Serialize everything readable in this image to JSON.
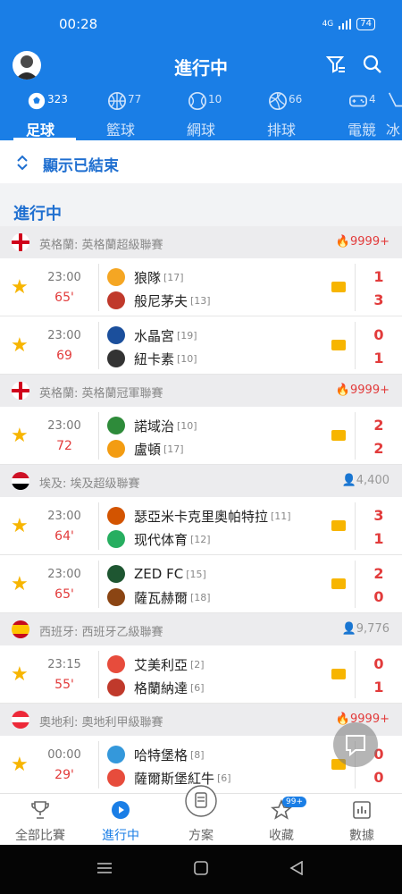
{
  "status": {
    "time": "00:28",
    "battery": "74",
    "network": "4G"
  },
  "header": {
    "title": "進行中"
  },
  "tabs": [
    {
      "label": "足球",
      "count": "323"
    },
    {
      "label": "籃球",
      "count": "77"
    },
    {
      "label": "網球",
      "count": "10"
    },
    {
      "label": "排球",
      "count": "66"
    },
    {
      "label": "電競",
      "count": "4"
    },
    {
      "label": "冰",
      "count": ""
    }
  ],
  "show_ended": "顯示已結束",
  "section_title": "進行中",
  "leagues": [
    {
      "name": "英格蘭: 英格蘭超級聯賽",
      "count": "9999+",
      "hot": true
    },
    {
      "name": "英格蘭: 英格蘭冠軍聯賽",
      "count": "9999+",
      "hot": true
    },
    {
      "name": "埃及: 埃及超级聯賽",
      "count": "4,400",
      "hot": false
    },
    {
      "name": "西班牙: 西班牙乙級聯賽",
      "count": "9,776",
      "hot": false
    },
    {
      "name": "奧地利: 奧地利甲級聯賽",
      "count": "9999+",
      "hot": true
    }
  ],
  "matches": [
    {
      "time": "23:00",
      "minute": "65'",
      "home": {
        "name": "狼隊",
        "rank": "[17]",
        "score": "1"
      },
      "away": {
        "name": "般尼茅夫",
        "rank": "[13]",
        "score": "3"
      }
    },
    {
      "time": "23:00",
      "minute": "69",
      "home": {
        "name": "水晶宮",
        "rank": "[19]",
        "score": "0"
      },
      "away": {
        "name": "紐卡素",
        "rank": "[10]",
        "score": "1"
      }
    },
    {
      "time": "23:00",
      "minute": "72",
      "home": {
        "name": "諾域治",
        "rank": "[10]",
        "score": "2"
      },
      "away": {
        "name": "盧頓",
        "rank": "[17]",
        "score": "2"
      }
    },
    {
      "time": "23:00",
      "minute": "64'",
      "home": {
        "name": "瑟亞米卡克里奧帕特拉",
        "rank": "[11]",
        "score": "3"
      },
      "away": {
        "name": "现代体育",
        "rank": "[12]",
        "score": "1"
      }
    },
    {
      "time": "23:00",
      "minute": "65'",
      "home": {
        "name": "ZED FC",
        "rank": "[15]",
        "score": "2"
      },
      "away": {
        "name": "薩瓦赫爾",
        "rank": "[18]",
        "score": "0"
      }
    },
    {
      "time": "23:15",
      "minute": "55'",
      "home": {
        "name": "艾美利亞",
        "rank": "[2]",
        "score": "0"
      },
      "away": {
        "name": "格蘭納達",
        "rank": "[6]",
        "score": "1"
      }
    },
    {
      "time": "00:00",
      "minute": "29'",
      "home": {
        "name": "哈特堡格",
        "rank": "[8]",
        "score": "0"
      },
      "away": {
        "name": "薩爾斯堡紅牛",
        "rank": "[6]",
        "score": "0"
      }
    }
  ],
  "bottom_nav": [
    {
      "label": "全部比賽"
    },
    {
      "label": "進行中"
    },
    {
      "label": "方案"
    },
    {
      "label": "收藏",
      "badge": "99+"
    },
    {
      "label": "數據"
    }
  ],
  "colors": {
    "primary": "#1a7ee6",
    "score": "#e23b3b",
    "star": "#f7b500"
  }
}
